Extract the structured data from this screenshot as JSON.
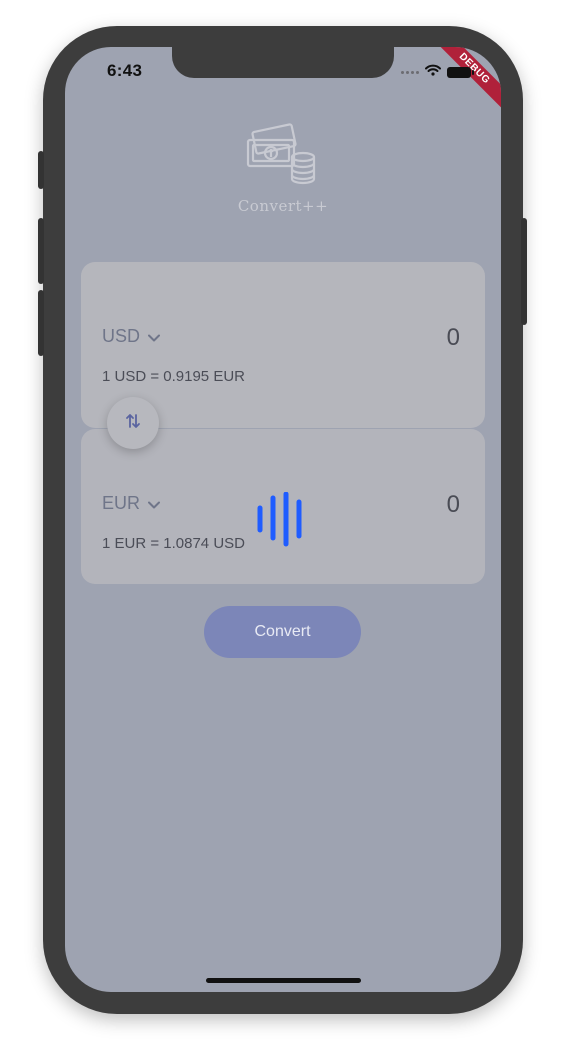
{
  "status_bar": {
    "time": "6:43",
    "banner": "DEBUG",
    "icons": [
      "cellular-dots-icon",
      "wifi-icon",
      "battery-icon"
    ]
  },
  "app": {
    "logo_text": "Convert++",
    "logo_icon": "money-coins-icon"
  },
  "from_card": {
    "currency": "USD",
    "amount": "0",
    "rate": "1 USD = 0.9195 EUR"
  },
  "to_card": {
    "currency": "EUR",
    "amount": "0",
    "rate": "1 EUR = 1.0874 USD"
  },
  "swap_icon": "swap-vertical-arrows-icon",
  "convert_button": {
    "label": "Convert"
  },
  "loading_indicator": {
    "icon": "audio-bars-loading-icon",
    "color": "#1f5cff"
  },
  "colors": {
    "overlay": "#9ea3b1",
    "card": "#b5b6bc",
    "button": "#7c86b8",
    "accent": "#1f5cff",
    "debug_banner": "#b0213a"
  }
}
